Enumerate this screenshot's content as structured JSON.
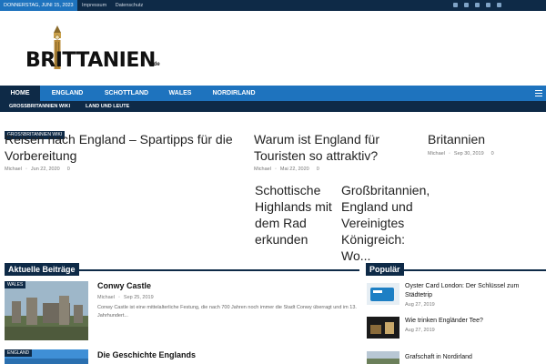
{
  "topbar": {
    "date": "DONNERSTAG, JUNI 15, 2023",
    "links": [
      "Impressum",
      "Datenschutz"
    ]
  },
  "logo": {
    "word": "BRITTANIEN",
    "tld": ".de"
  },
  "nav": {
    "items": [
      "HOME",
      "ENGLAND",
      "SCHOTTLAND",
      "WALES",
      "NORDIRLAND"
    ],
    "active": "HOME"
  },
  "subnav": {
    "items": [
      "GROSSBRITANNIEN WIKI",
      "LAND UND LEUTE"
    ]
  },
  "featured": [
    {
      "badge": "GROSSBRITANNIEN WIKI",
      "title": "Reisen nach England – Spartipps für die Vorbereitung",
      "author": "Michael",
      "date": "Jun 22, 2020",
      "comments": "0"
    },
    {
      "title": "Warum ist England für Touristen so attraktiv?",
      "author": "Michael",
      "date": "Mai 22, 2020",
      "comments": "0"
    },
    {
      "title": "Britannien",
      "author": "Michael",
      "date": "Sep 30, 2019",
      "comments": "0"
    },
    {
      "title": "Schottische Highlands mit dem Rad erkunden"
    },
    {
      "title": "Großbritannien, England und Vereinigtes Königreich: Wo..."
    }
  ],
  "latest": {
    "heading": "Aktuelle Beiträge",
    "posts": [
      {
        "category": "WALES",
        "title": "Conwy Castle",
        "author": "Michael",
        "date": "Sep 25, 2019",
        "excerpt": "Conwy Castle ist eine mittelalterliche Festung, die nach 700 Jahren noch immer die Stadt Conwy überragt und im 13. Jahrhundert..."
      },
      {
        "category": "ENGLAND",
        "title": "Die Geschichte Englands"
      }
    ]
  },
  "popular": {
    "heading": "Populär",
    "posts": [
      {
        "title": "Oyster Card London: Der Schlüssel zum Städtetrip",
        "date": "Aug 27, 2019"
      },
      {
        "title": "Wie trinken Engländer Tee?",
        "date": "Aug 27, 2019"
      },
      {
        "title": "Grafschaft in Nordirland",
        "date": ""
      }
    ]
  }
}
